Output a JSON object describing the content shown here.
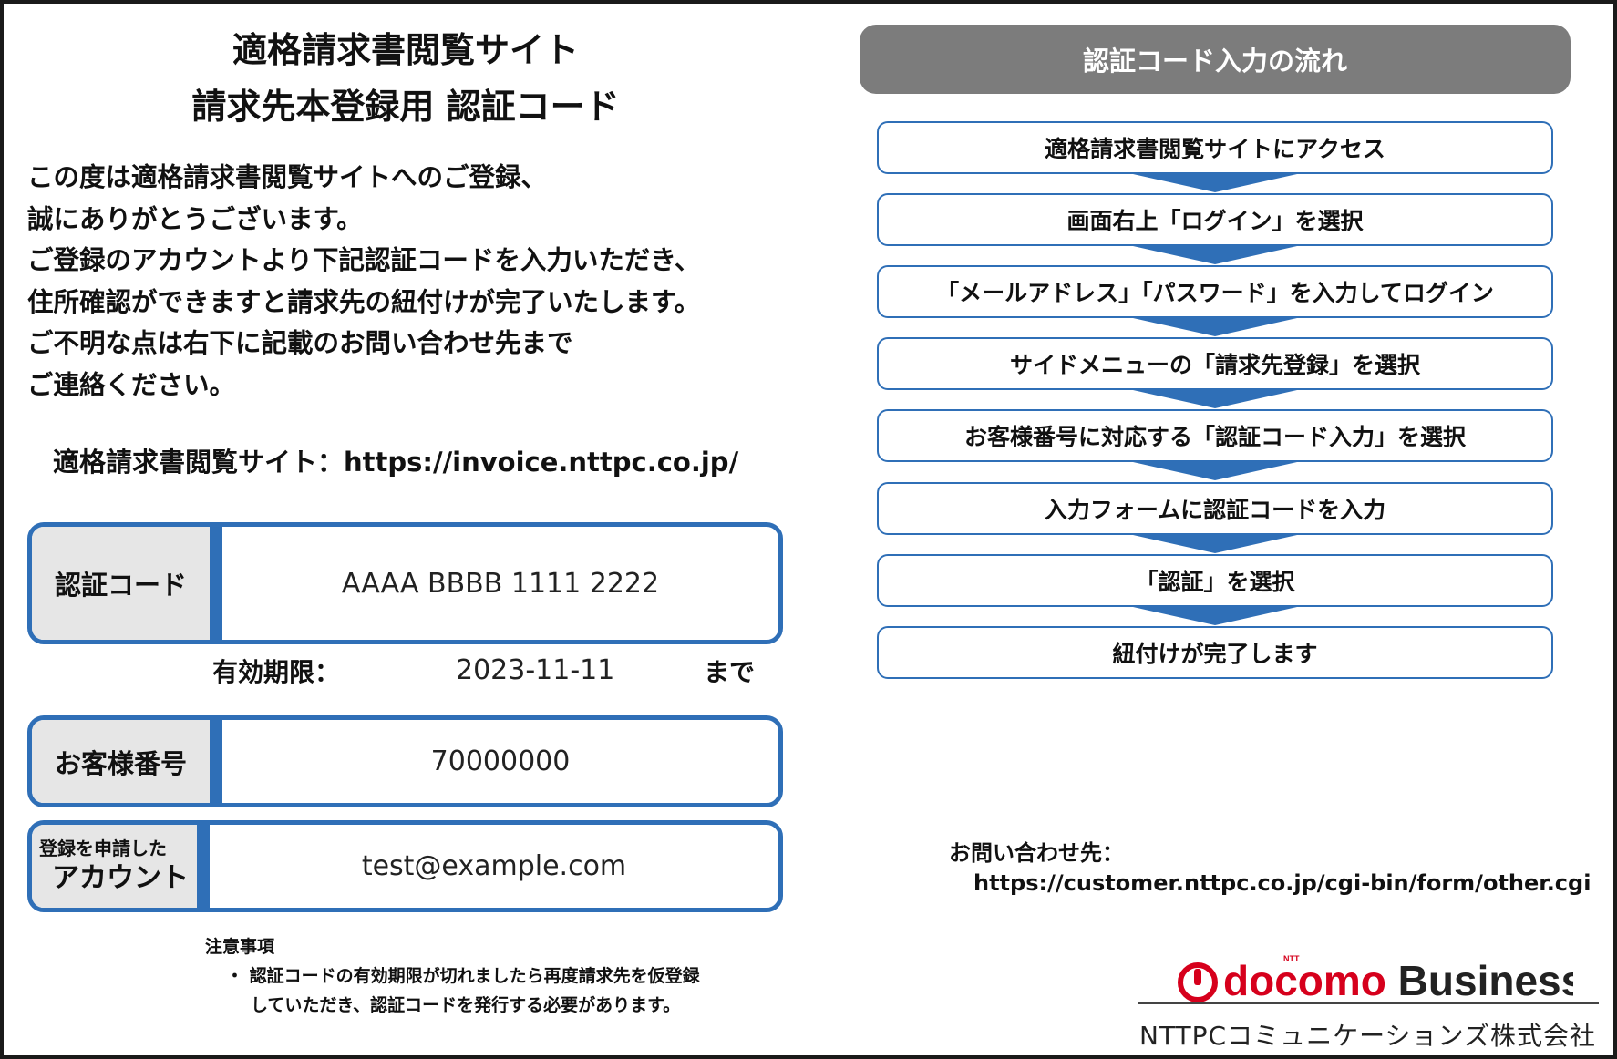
{
  "title": {
    "line1": "適格請求書閲覧サイト",
    "line2": "請求先本登録用 認証コード"
  },
  "intro": [
    "この度は適格請求書閲覧サイトへのご登録、",
    "誠にありがとうございます。",
    "ご登録のアカウントより下記認証コードを入力いただき、",
    "住所確認ができますと請求先の紐付けが完了いたします。",
    "ご不明な点は右下に記載のお問い合わせ先まで",
    "ご連絡ください。"
  ],
  "site": "適格請求書閲覧サイト：https://invoice.nttpc.co.jp/",
  "auth": {
    "label": "認証コード",
    "value": "AAAA BBBB 1111 2222"
  },
  "expiry": {
    "label": "有効期限：",
    "value": "2023-11-11",
    "suffix": "まで"
  },
  "customer": {
    "label": "お客様番号",
    "value": "70000000"
  },
  "account": {
    "label_line1": "登録を申請した",
    "label_line2": "アカウント",
    "value": "test@example.com"
  },
  "notes": {
    "title": "注意事項",
    "lines": [
      "・ 認証コードの有効期限が切れましたら再度請求先を仮登録",
      "していただき、認証コードを発行する必要があります。"
    ]
  },
  "flow": {
    "header": "認証コード入力の流れ",
    "steps": [
      "適格請求書閲覧サイトにアクセス",
      "画面右上「ログイン」を選択",
      "「メールアドレス」「パスワード」を入力してログイン",
      "サイドメニューの「請求先登録」を選択",
      "お客様番号に対応する「認証コード入力」を選択",
      "入力フォームに認証コードを入力",
      "「認証」を選択",
      "紐付けが完了します"
    ]
  },
  "contact": {
    "label": "お問い合わせ先：",
    "url": "https://customer.nttpc.co.jp/cgi-bin/form/other.cgi"
  },
  "logo": {
    "small": "NTT",
    "text": "docomo Business",
    "icon": "docomo-circle-logo",
    "color": "#d6001c"
  },
  "company": "NTTPCコミュニケーションズ株式会社",
  "colors": {
    "accent": "#2f6fb7",
    "header_bg": "#7c7c7c",
    "label_bg": "#e6e6e6"
  }
}
